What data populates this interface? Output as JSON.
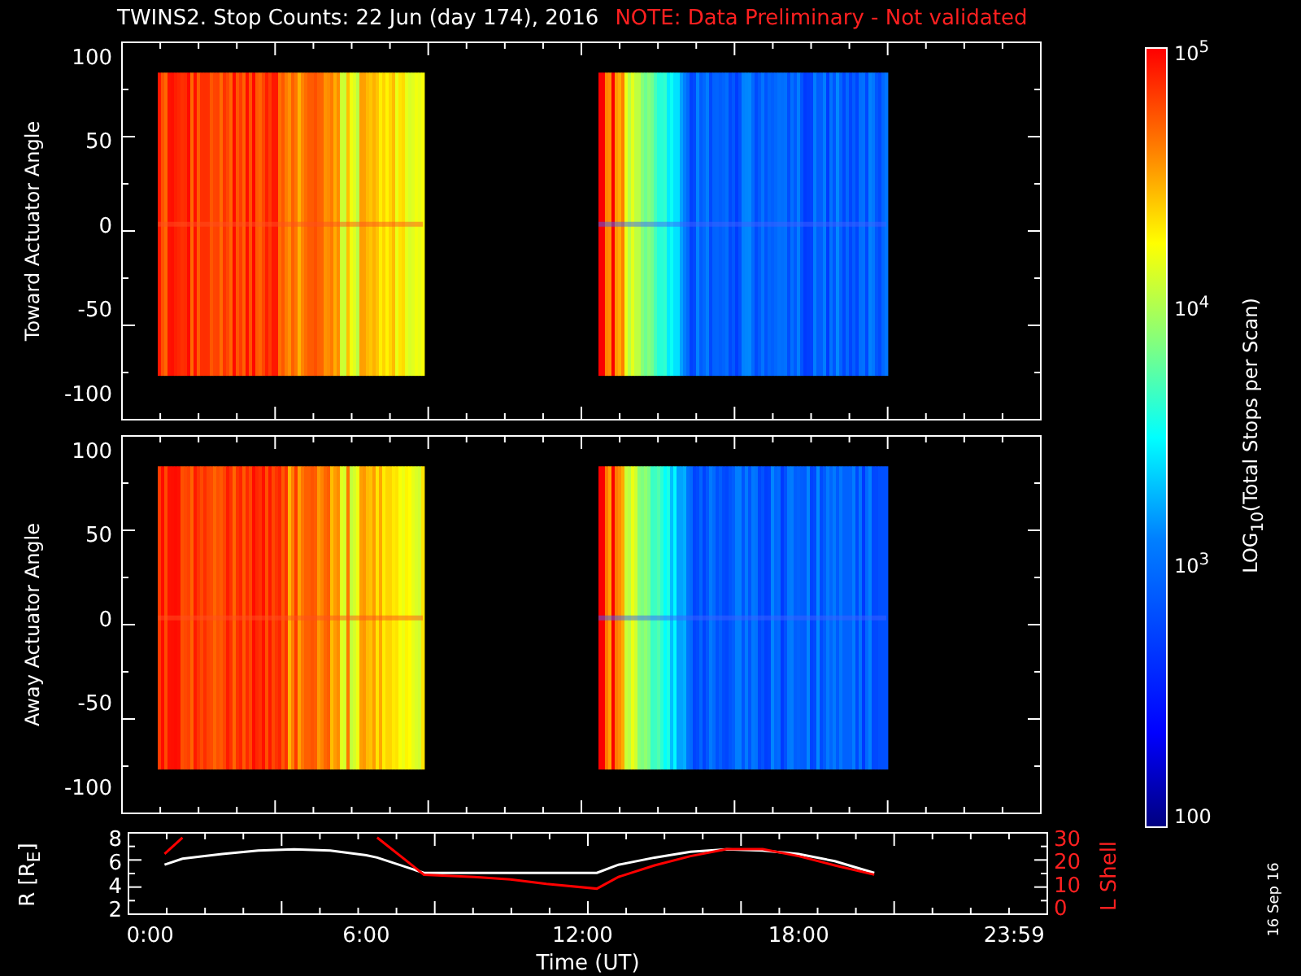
{
  "title": "TWINS2. Stop Counts: 22 Jun (day 174), 2016",
  "note": "NOTE: Data Preliminary - Not validated",
  "panels": [
    {
      "ylabel": "Toward Actuator Angle",
      "yticks": [
        "100",
        "50",
        "0",
        "-50",
        "-100"
      ]
    },
    {
      "ylabel": "Away Actuator Angle",
      "yticks": [
        "100",
        "50",
        "0",
        "-50",
        "-100"
      ]
    }
  ],
  "colorbar": {
    "label": "LOG$_{10}$(Total Stops per Scan)",
    "ticks": [
      "10$^{5}$",
      "10$^{4}$",
      "10$^{3}$",
      "100"
    ]
  },
  "orbit": {
    "chart_data": {
      "type": "line",
      "xlabel": "Time (UT)",
      "ylabel": "R [R$_{E}$]",
      "xlim": [
        -0.6,
        24.9
      ],
      "ylim": [
        1.5,
        8.4
      ],
      "x": [
        0.4,
        0.9,
        2,
        3,
        4,
        5,
        6,
        6.3,
        7.6,
        9,
        10,
        11,
        12.4,
        13,
        14,
        15,
        16,
        17,
        18,
        19,
        20.1
      ],
      "series": [
        {
          "color": "#ffffff",
          "values": [
            5.7,
            6.2,
            6.6,
            6.9,
            7.0,
            6.9,
            6.5,
            6.3,
            5.0,
            5.0,
            5.0,
            5.0,
            5.0,
            5.7,
            6.3,
            6.8,
            7.0,
            6.9,
            6.6,
            6.0,
            5.0
          ]
        }
      ],
      "xticks": [
        {
          "value": 0,
          "label": "0:00"
        },
        {
          "value": 6,
          "label": "6:00"
        },
        {
          "value": 12,
          "label": "12:00"
        },
        {
          "value": 18,
          "label": "18:00"
        },
        {
          "value": 23.98,
          "label": "23:59"
        }
      ],
      "yticks": [
        2,
        4,
        6,
        8
      ]
    },
    "l_shell": {
      "chart_data": {
        "type": "line",
        "ylabel": "L Shell",
        "xlim": [
          -0.6,
          24.9
        ],
        "ylim": [
          -3,
          32
        ],
        "x": [
          0.4,
          0.9,
          6.3,
          7.6,
          9,
          10,
          11,
          12.4,
          13,
          14,
          15,
          16,
          17,
          18,
          19,
          20.1
        ],
        "series": [
          {
            "color": "#ff0000",
            "values": [
              23,
              30,
              null,
              null,
              null,
              null,
              null,
              null,
              null,
              null,
              null,
              null,
              null,
              null,
              null,
              null
            ]
          },
          {
            "color": "#ff0000",
            "values": [
              null,
              null,
              30,
              14,
              13,
              12,
              10,
              8,
              13,
              18,
              22,
              25,
              25,
              22,
              18,
              14
            ]
          }
        ],
        "yticks": [
          0,
          10,
          20,
          30
        ]
      }
    }
  },
  "date": "16 Sep 16"
}
